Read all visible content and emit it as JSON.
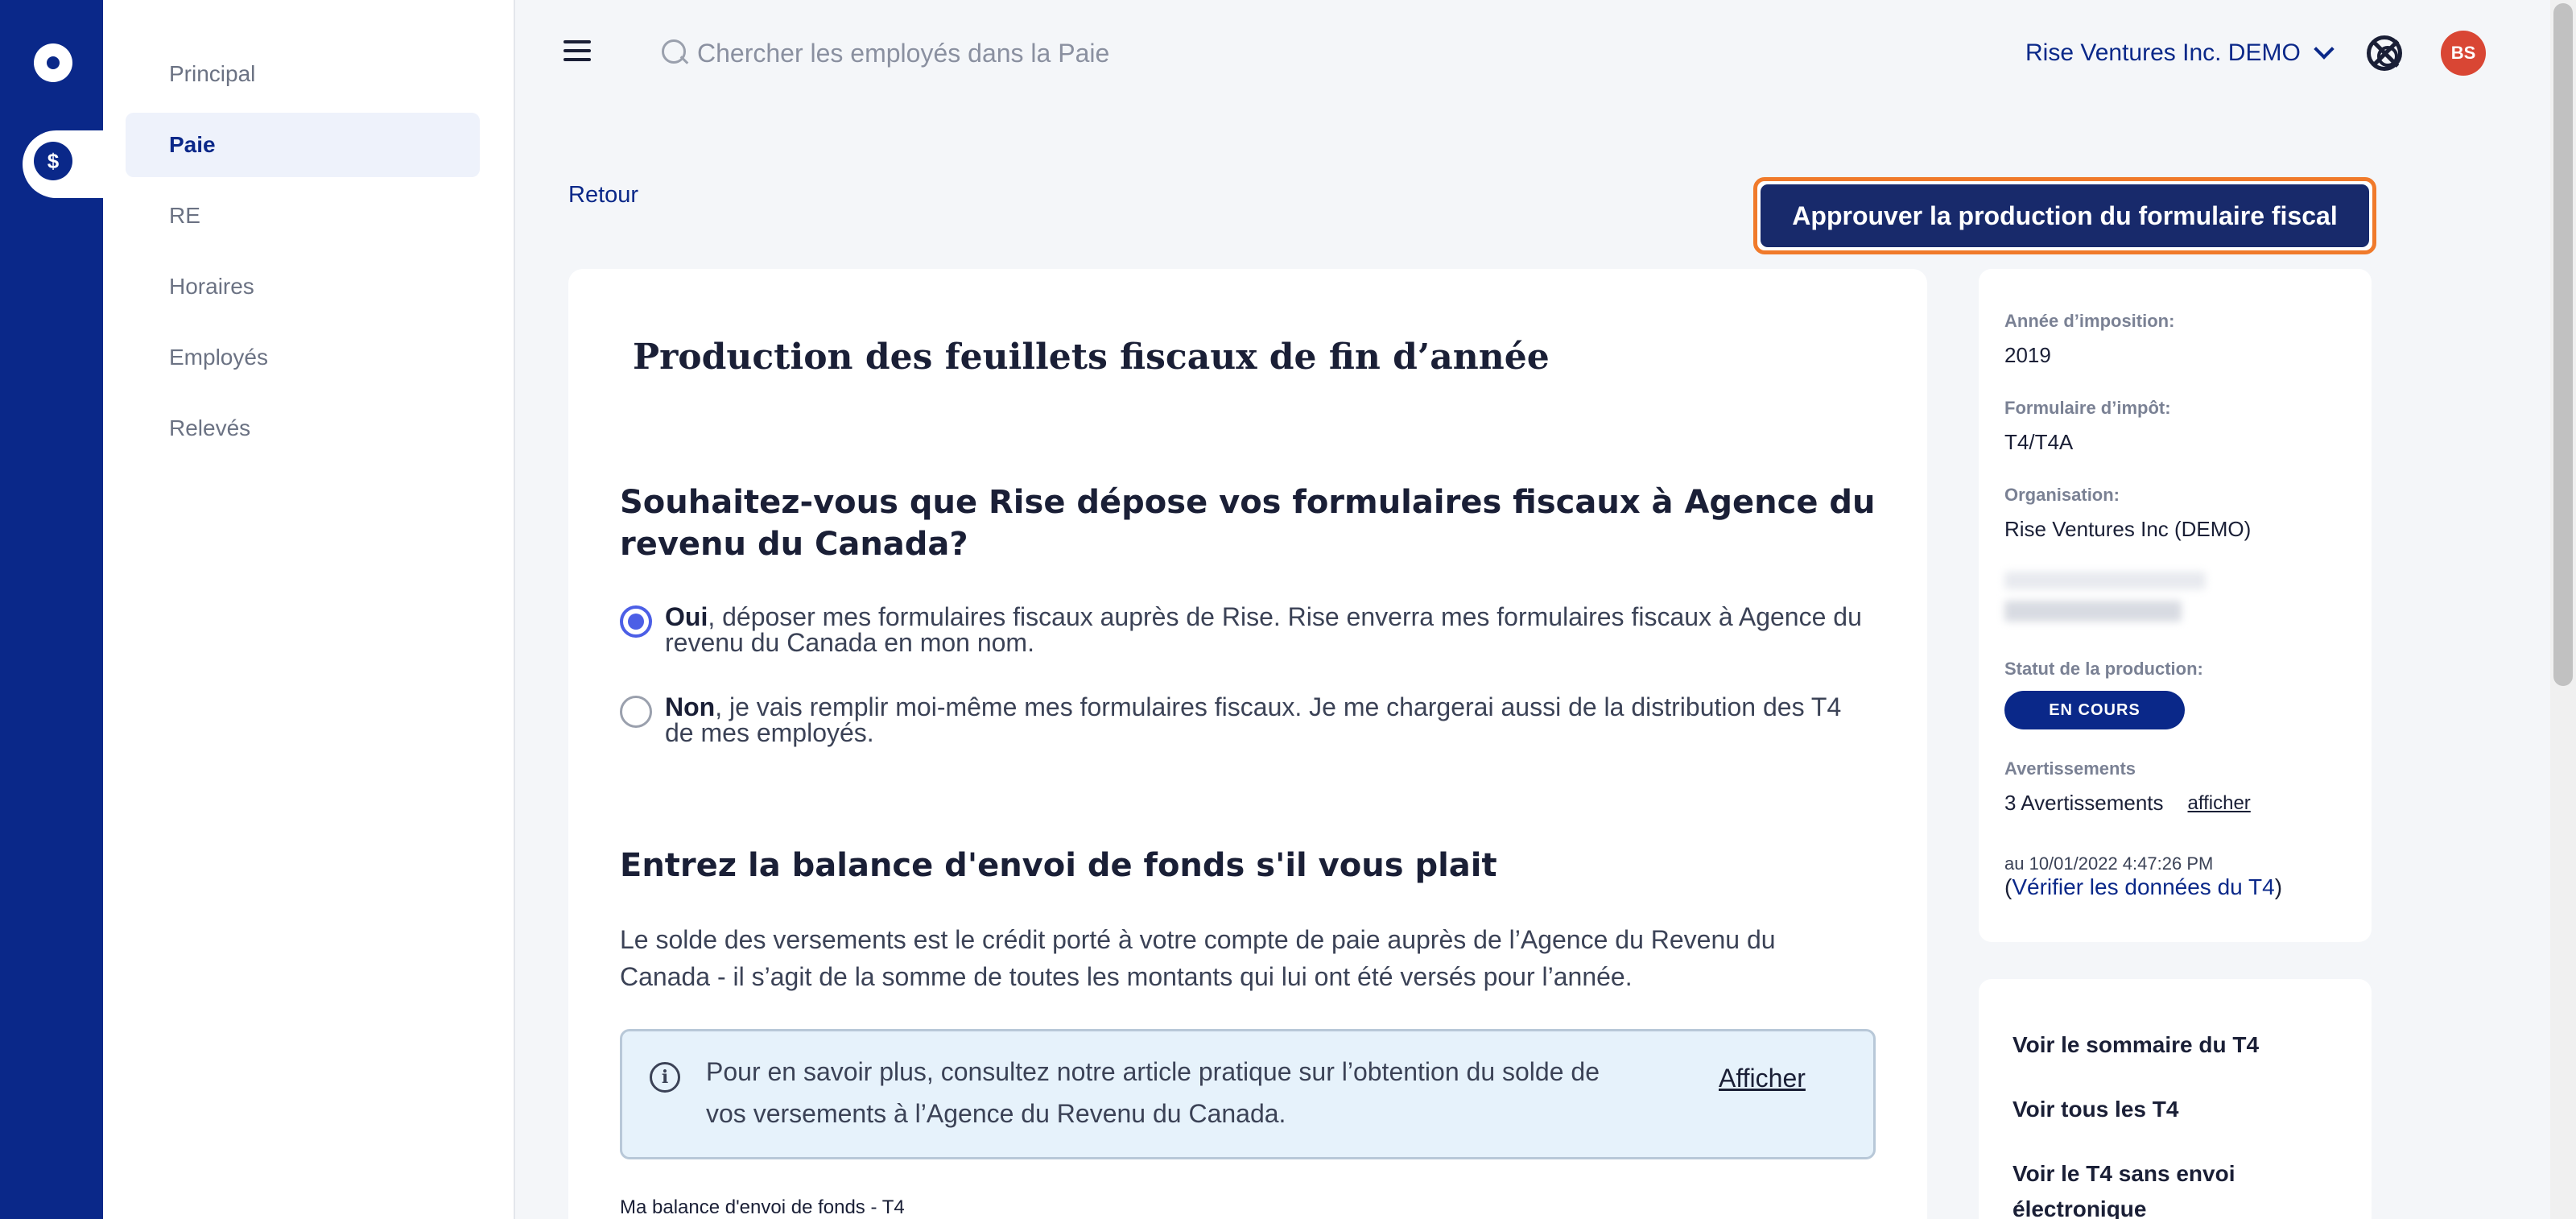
{
  "nav": {
    "items": [
      {
        "label": "Principal"
      },
      {
        "label": "Paie"
      },
      {
        "label": "RE"
      },
      {
        "label": "Horaires"
      },
      {
        "label": "Employés"
      },
      {
        "label": "Relevés"
      }
    ],
    "active": "Paie"
  },
  "topbar": {
    "search_placeholder": "Chercher les employés dans la Paie",
    "org_name": "Rise Ventures Inc. DEMO",
    "avatar_initials": "BS"
  },
  "page": {
    "back_label": "Retour",
    "approve_label": "Approuver la production du formulaire fiscal",
    "title": "Production des feuillets fiscaux de fin d’année",
    "question": "Souhaitez-vous que Rise dépose vos formulaires fiscaux à Agence du revenu du Canada?",
    "option_yes_bold": "Oui",
    "option_yes_text": ", déposer mes formulaires fiscaux auprès de Rise. Rise enverra mes formulaires fiscaux à Agence du revenu du Canada en mon nom.",
    "option_no_bold": "Non",
    "option_no_text": ", je vais remplir moi-même mes formulaires fiscaux. Je me chargerai aussi de la distribution des T4 de mes employés.",
    "selected_option": "Oui",
    "remittance_title": "Entrez la balance d'envoi de fonds s'il vous plait",
    "remittance_desc": "Le solde des versements est le crédit porté à votre compte de paie auprès de l’Agence du Revenu du Canada - il s’agit de la somme de toutes les montants qui lui ont été versés pour l’année.",
    "info_text": "Pour en savoir plus, consultez notre article pratique sur l’obtention du solde de vos versements à l’Agence du Revenu du Canada.",
    "info_link": "Afficher",
    "field_label": "Ma balance d'envoi de fonds - T4"
  },
  "side_panel": {
    "tax_year_label": "Année d’imposition:",
    "tax_year": "2019",
    "form_label": "Formulaire d’impôt:",
    "form": "T4/T4A",
    "org_label": "Organisation:",
    "org": "Rise Ventures Inc (DEMO)",
    "status_label": "Statut de la production:",
    "status": "EN COURS",
    "warnings_label": "Avertissements",
    "warnings_count": "3 Avertissements",
    "warnings_link": "afficher",
    "timestamp": "au 10/01/2022 4:47:26 PM",
    "verify_open": "(",
    "verify_link": "Vérifier les données du T4",
    "verify_close": ")"
  },
  "side_links": [
    {
      "label": "Voir le sommaire du T4"
    },
    {
      "label": "Voir tous les T4"
    },
    {
      "label": "Voir le T4 sans envoi électronique"
    }
  ],
  "colors": {
    "rail": "#0a2889",
    "primary_button": "#182a6b",
    "focus_ring": "#f07a2b",
    "radio_checked": "#4c5fe6",
    "avatar": "#d94634"
  },
  "icons": {
    "rail_top": "rise-logo-icon",
    "rail_active": "dollar-icon",
    "menu": "hamburger-icon",
    "search": "search-icon",
    "help": "lifebuoy-icon",
    "info": "info-icon"
  }
}
